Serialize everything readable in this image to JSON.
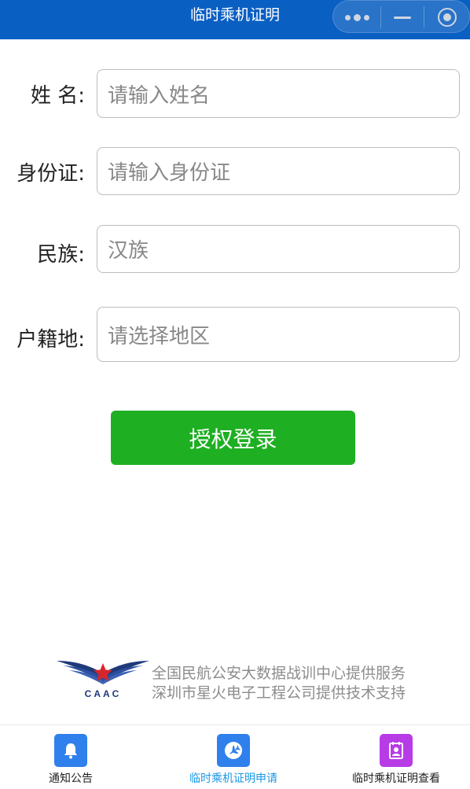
{
  "header": {
    "title": "临时乘机证明"
  },
  "form": {
    "name": {
      "label": "姓 名:",
      "placeholder": "请输入姓名"
    },
    "id_card": {
      "label": "身份证:",
      "placeholder": "请输入身份证"
    },
    "ethnicity": {
      "label": "民族:",
      "value": "汉族"
    },
    "household": {
      "label": "户籍地:",
      "placeholder": "请选择地区"
    },
    "submit_label": "授权登录"
  },
  "footer": {
    "logo_text": "CAAC",
    "credit_line1": "全国民航公安大数据战训中心提供服务",
    "credit_line2": "深圳市星火电子工程公司提供技术支持"
  },
  "tabbar": {
    "items": [
      {
        "label": "通知公告",
        "icon": "bell-icon",
        "color": "#2f80ed",
        "active": false
      },
      {
        "label": "临时乘机证明申请",
        "icon": "airplane-icon",
        "color": "#2f80ed",
        "active": true
      },
      {
        "label": "临时乘机证明查看",
        "icon": "id-card-icon",
        "color": "#b83ce6",
        "active": false
      }
    ],
    "active_color": "#1a98e6",
    "inactive_color": "#222222"
  },
  "colors": {
    "header_bg": "#0a5fc2",
    "button_bg": "#1eaf22"
  }
}
